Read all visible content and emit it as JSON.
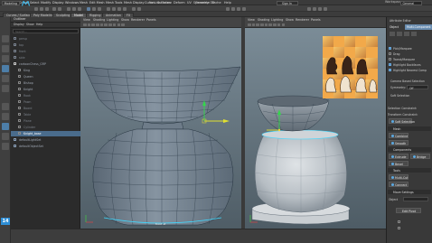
{
  "menubar": {
    "items": [
      "File",
      "Edit",
      "Create",
      "Select",
      "Modify",
      "Display",
      "Windows",
      "Mesh",
      "Edit Mesh",
      "Mesh Tools",
      "Mesh Display",
      "Curves",
      "Surfaces",
      "Deform",
      "UV",
      "Generate",
      "Cache",
      "Help"
    ],
    "workspace_label": "Workspace:",
    "workspace_value": "General"
  },
  "statusbar": {
    "mode": "Modeling",
    "no_live_surface": "No Live Surface",
    "symmetry": "Symmetry: Off",
    "sign_in": "Sign In"
  },
  "tabs": [
    {
      "label": "Curves / Surfaces",
      "active": false
    },
    {
      "label": "Poly Modeling",
      "active": false
    },
    {
      "label": "Sculpting",
      "active": false
    },
    {
      "label": "Model",
      "active": true
    },
    {
      "label": "Rigging",
      "active": false
    },
    {
      "label": "Animation",
      "active": false
    },
    {
      "label": "FX",
      "active": false
    }
  ],
  "outliner": {
    "title": "Outliner",
    "menu": [
      "Display",
      "Show",
      "Help"
    ],
    "search_placeholder": "Search...",
    "rows": [
      {
        "label": "persp",
        "type": "cam",
        "state": "dim"
      },
      {
        "label": "top",
        "type": "cam",
        "state": "dim"
      },
      {
        "label": "front",
        "type": "cam",
        "state": "dim"
      },
      {
        "label": "side",
        "type": "cam",
        "state": "dim"
      },
      {
        "label": "cartoonChess_GRP",
        "type": "grp",
        "state": "normal"
      },
      {
        "label": "King",
        "type": "mesh",
        "state": "normal"
      },
      {
        "label": "Queen",
        "type": "mesh",
        "state": "normal"
      },
      {
        "label": "Bishop",
        "type": "mesh",
        "state": "normal"
      },
      {
        "label": "Knight",
        "type": "mesh",
        "state": "normal"
      },
      {
        "label": "Rook",
        "type": "mesh",
        "state": "dim"
      },
      {
        "label": "Pawn",
        "type": "mesh",
        "state": "dim"
      },
      {
        "label": "Board",
        "type": "mesh",
        "state": "dim"
      },
      {
        "label": "Table",
        "type": "mesh",
        "state": "dim"
      },
      {
        "label": "Plane",
        "type": "mesh",
        "state": "dim"
      },
      {
        "label": "Cylinder",
        "type": "mesh",
        "state": "dim"
      },
      {
        "label": "Knight_base",
        "type": "mesh",
        "state": "highlight"
      },
      {
        "label": "defaultLightSet",
        "type": "set",
        "state": "normal"
      },
      {
        "label": "defaultObjectSet",
        "type": "set",
        "state": "normal"
      }
    ]
  },
  "viewport": {
    "menu": [
      "View",
      "Shading",
      "Lighting",
      "Show",
      "Renderer",
      "Panels"
    ],
    "left_label": "front -Z",
    "tool_number": "14"
  },
  "right_panel": {
    "tabs": [
      "Attribute Editor",
      "Modeling Toolkit"
    ],
    "object_label": "Object",
    "mode": "Multi-Component",
    "items": [
      {
        "label": "Pick/Marquee",
        "checked": true
      },
      {
        "label": "Drag",
        "checked": false
      },
      {
        "label": "Tweak/Marquee",
        "checked": false
      },
      {
        "label": "Highlight Backfaces",
        "checked": true
      },
      {
        "label": "Highlight Nearest Comp",
        "checked": true
      }
    ],
    "camera_based": "Camera Based Selection",
    "symmetry_label": "Symmetry:",
    "symmetry_value": "Off",
    "soft_selection": "Soft Selection",
    "selection_constraint": "Selection Constraint:",
    "transform_constraint": "Transform Constraint:",
    "soft_select_label": "Soft Selection",
    "sections": {
      "mesh": "Mesh",
      "components": "Components",
      "tools": "Tools",
      "move": "Move Settings"
    },
    "buttons": {
      "combine": "Combine",
      "smooth": "Smooth",
      "extrude": "Extrude",
      "bevel": "Bevel",
      "bridge": "Bridge",
      "multi_cut": "Multi-Cut",
      "connect": "Connect",
      "edit_pivot": "Edit Pivot"
    },
    "axis_label": "Object",
    "colors": {
      "accent": "#3d86c6",
      "section": "#2e2e2e"
    }
  }
}
